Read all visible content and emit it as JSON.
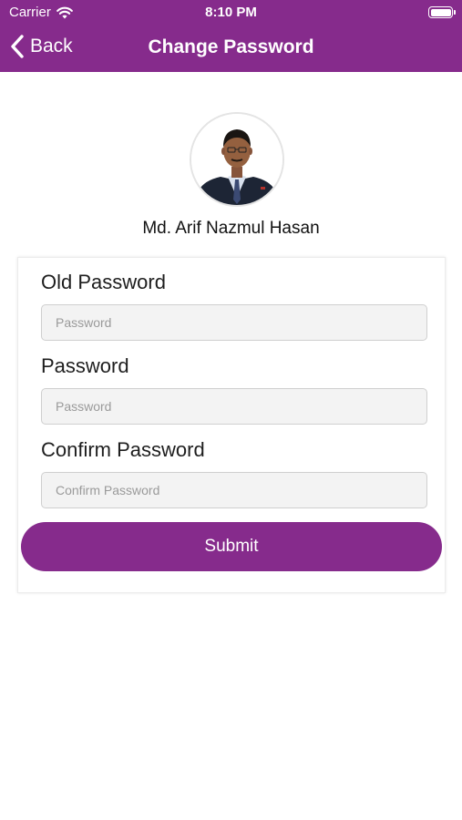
{
  "status_bar": {
    "carrier": "Carrier",
    "time": "8:10 PM",
    "wifi_icon": "wifi-icon",
    "battery_icon": "battery-icon"
  },
  "nav": {
    "back_label": "Back",
    "back_icon": "chevron-left-icon",
    "title": "Change Password",
    "background_color": "#862b8c"
  },
  "profile": {
    "name": "Md. Arif Nazmul Hasan"
  },
  "form": {
    "old_password": {
      "label": "Old Password",
      "placeholder": "Password",
      "value": ""
    },
    "password": {
      "label": "Password",
      "placeholder": "Password",
      "value": ""
    },
    "confirm_password": {
      "label": "Confirm Password",
      "placeholder": "Confirm Password",
      "value": ""
    },
    "submit_label": "Submit"
  },
  "colors": {
    "accent": "#862b8c",
    "input_background": "#f3f3f3"
  }
}
